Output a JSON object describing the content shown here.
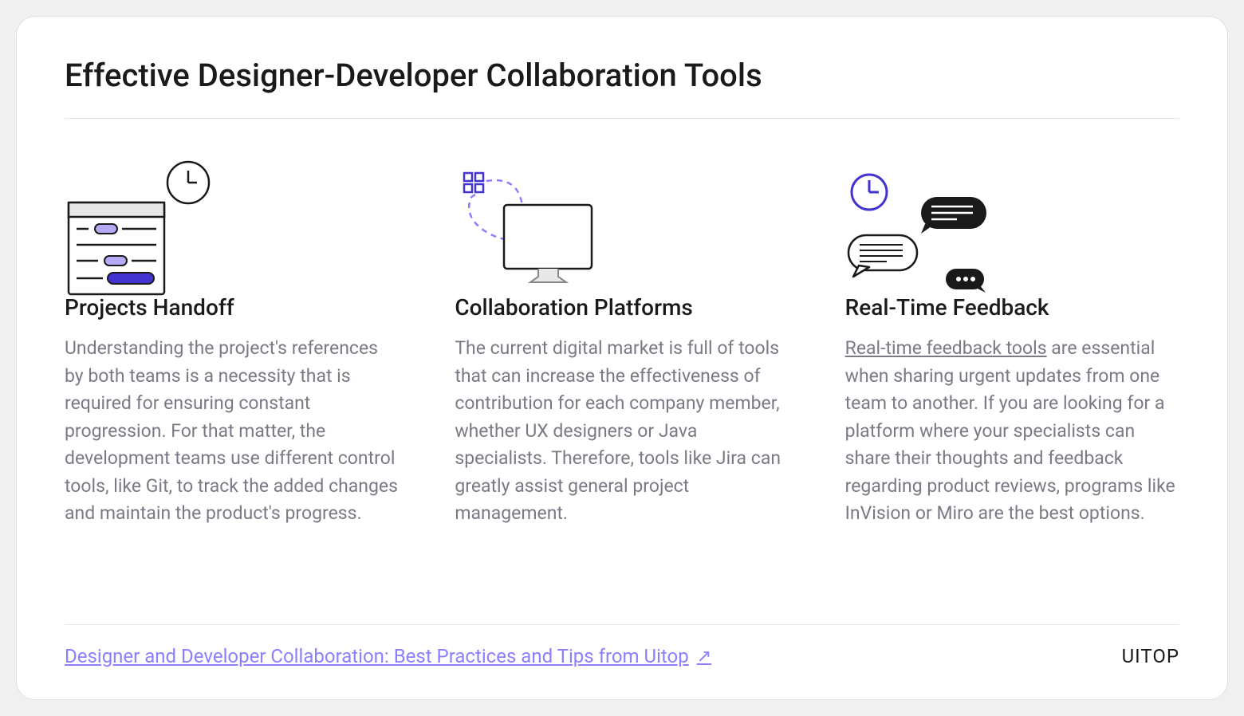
{
  "title": "Effective Designer-Developer Collaboration Tools",
  "columns": [
    {
      "title": "Projects Handoff",
      "text": "Understanding the project's references by both teams is a necessity that is required for ensuring constant progression. For that matter, the development teams use different control tools, like Git, to track the added changes and maintain the product's progress."
    },
    {
      "title": "Collaboration Platforms",
      "text": "The current digital market is full of tools that can increase the effectiveness of contribution for each company member, whether UX designers or Java specialists. Therefore, tools like Jira can greatly assist general project management."
    },
    {
      "title": "Real-Time Feedback",
      "link_text": "Real-time feedback tools",
      "text_after": " are essential when sharing urgent updates from one team to another. If you are looking for a platform where your specialists can share their thoughts and feedback regarding product reviews, programs like InVision or Miro are the best options."
    }
  ],
  "footer": {
    "link_text": "Designer and Developer Collaboration: Best Practices and Tips from Uitop",
    "brand": "UITOP"
  }
}
